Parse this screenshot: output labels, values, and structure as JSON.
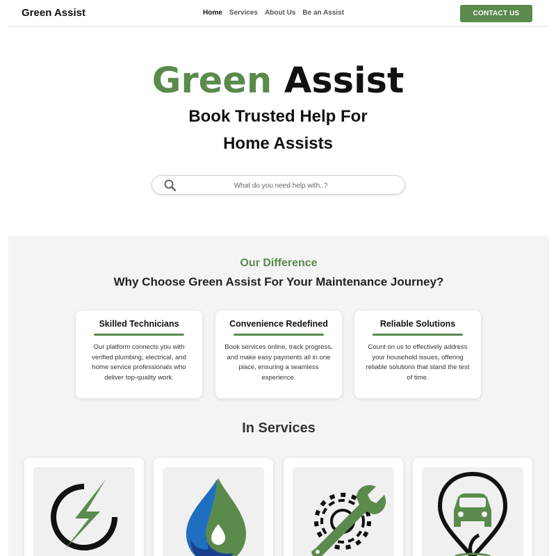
{
  "nav": {
    "brand": "Green Assist",
    "links": [
      "Home",
      "Services",
      "About Us",
      "Be an Assist"
    ],
    "cta": "CONTACT US"
  },
  "hero": {
    "title_green": "Green",
    "title_black": "Assist",
    "subtitle_line1": "Book Trusted Help For",
    "subtitle_line2": "Home Assists",
    "search_placeholder": "What do you need help with..?"
  },
  "difference": {
    "eyebrow": "Our Difference",
    "heading": "Why Choose Green Assist For Your Maintenance Journey?",
    "cards": [
      {
        "title": "Skilled Technicians",
        "text": "Our platform connects you with verified plumbing, electrical, and home service professionals who deliver top-quality work."
      },
      {
        "title": "Convenience Redefined",
        "text": "Book services online, track progress, and make easy payments all in one place, ensuring a seamless experience."
      },
      {
        "title": "Reliable Solutions",
        "text": "Count on us to effectively address your household issues, offering reliable solutions that stand the test of time."
      }
    ]
  },
  "services": {
    "title": "In Services",
    "icons": [
      "electric-bolt-icon",
      "water-drop-icon",
      "wrench-gear-icon",
      "car-location-pin-icon"
    ]
  },
  "colors": {
    "brand_green": "#5a8a4c",
    "section_bg": "#f4f4f4"
  }
}
